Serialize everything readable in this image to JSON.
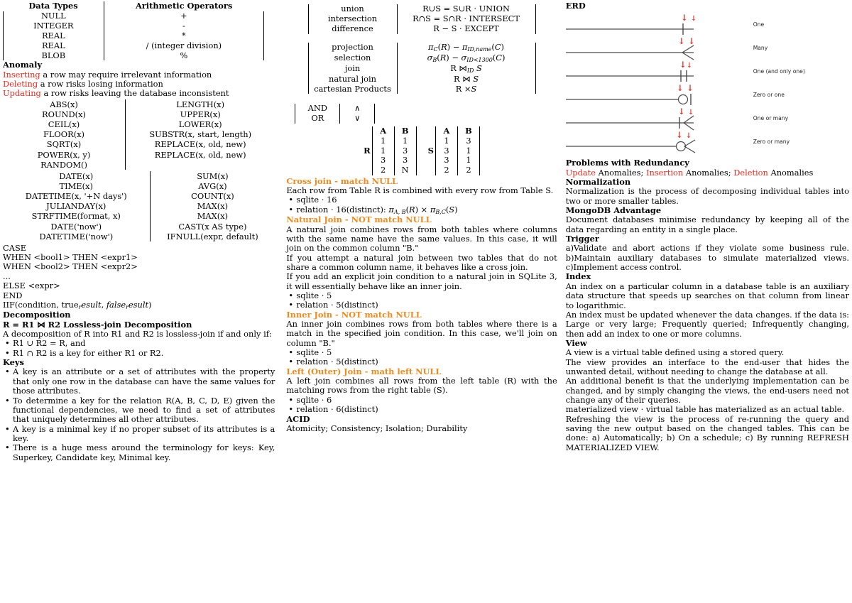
{
  "col1": {
    "datatypes_table": {
      "head_left": "Data Types",
      "head_right": "Arithmetic Operators",
      "rows": [
        {
          "type": "NULL",
          "op": "+"
        },
        {
          "type": "INTEGER",
          "op": "-"
        },
        {
          "type": "REAL",
          "op": "*"
        },
        {
          "type": "REAL",
          "op": "/ (integer division)"
        },
        {
          "type": "BLOB",
          "op": "%"
        }
      ]
    },
    "anomaly": {
      "heading": "Anomaly",
      "lines": [
        {
          "kw": "Inserting",
          "rest": " a row may require irrelevant information"
        },
        {
          "kw": "Deleting",
          "rest": " a row risks losing information"
        },
        {
          "kw": "Updating",
          "rest": " a row risks leaving the database inconsistent"
        }
      ]
    },
    "func_numeric": [
      "ABS(x)",
      "ROUND(x)",
      "CEIL(x)",
      "FLOOR(x)",
      "SQRT(x)",
      "POWER(x, y)",
      "RANDOM()"
    ],
    "func_string": [
      "LENGTH(x)",
      "UPPER(x)",
      "LOWER(x)",
      "SUBSTR(x, start, length)",
      "REPLACE(x, old, new)",
      "REPLACE(x, old, new)"
    ],
    "func_date": [
      "DATE(x)",
      "TIME(x)",
      "DATETIME(x, '+N days')",
      "JULIANDAY(x)",
      "STRFTIME(format, x)",
      "DATE('now')",
      "DATETIME('now')"
    ],
    "func_agg": [
      "SUM(x)",
      "AVG(x)",
      "COUNT(x)",
      "MAX(x)",
      "MAX(x)",
      "CAST(x AS type)",
      "IFNULL(expr, default)"
    ],
    "case_block": [
      "CASE",
      "WHEN <bool1> THEN <expr1>",
      "WHEN <bool2> THEN <expr2>",
      "...",
      "ELSE <expr>",
      "END"
    ],
    "iif": {
      "prefix": "IIF(condition, true",
      "sub1": "r",
      "mid1": "esult",
      "sep": ", ",
      "it2": "false",
      "sub2": "r",
      "mid2": "esult",
      "suffix": ")"
    },
    "decomposition": {
      "heading": "Decomposition",
      "formula": "R = R1 ⋈ R2 Lossless-join Decomposition",
      "body": "A decomposition of R into R1 and R2 is lossless-join if and only if:",
      "bullets": [
        "R1 ∪ R2 = R, and",
        "R1 ∩ R2 is a key for either R1 or R2."
      ]
    },
    "keys": {
      "heading": "Keys",
      "bullets": [
        "A key is an attribute or a set of attributes with the property that only one row in the database can have the same values for those attributes.",
        "To determine a key for the relation R(A, B, C, D, E) given the functional dependencies, we need to find a set of attributes that uniquely determines all other attributes.",
        "A key is a minimal key if no proper subset of its attributes is a key.",
        "There is a huge mess around the terminology for keys: Key, Superkey, Candidate key, Minimal key."
      ]
    }
  },
  "col2": {
    "setops": [
      {
        "name": "union",
        "expr": "R∪S = S∪R · UNION"
      },
      {
        "name": "intersection",
        "expr": "R∩S = S∩R · INTERSECT"
      },
      {
        "name": "difference",
        "expr": "R − S · EXCEPT"
      }
    ],
    "relops": [
      {
        "name": "projection",
        "expr": "πC(R) − πID,name(C)"
      },
      {
        "name": "selection",
        "expr": "σB(R) − σID<1300(C)"
      },
      {
        "name": "join",
        "expr": "R ⋈ID S"
      },
      {
        "name": "natural join",
        "expr": "R ⋈ S"
      },
      {
        "name": "cartesian Products",
        "expr": "R ×S"
      }
    ],
    "logic": [
      {
        "name": "AND",
        "sym": "∧"
      },
      {
        "name": "OR",
        "sym": "∨"
      }
    ],
    "relR": {
      "name": "R",
      "cols": [
        "A",
        "B"
      ],
      "rows": [
        [
          "1",
          "1"
        ],
        [
          "1",
          "3"
        ],
        [
          "3",
          "3"
        ],
        [
          "2",
          "N"
        ]
      ]
    },
    "relS": {
      "name": "S",
      "cols": [
        "A",
        "B"
      ],
      "rows": [
        [
          "1",
          "3"
        ],
        [
          "3",
          "1"
        ],
        [
          "3",
          "1"
        ],
        [
          "2",
          "2"
        ]
      ]
    },
    "joins": [
      {
        "title": "Cross join - match NULL",
        "body": [
          "Each row from Table R is combined with every row from Table S."
        ],
        "bullets": [
          "sqlite · 16"
        ],
        "bullet_formula": {
          "prefix": "relation · 16(distinct): ",
          "formula": "πA, B(R) × πB,C(S)"
        }
      },
      {
        "title": "Natural Join - NOT match NULL",
        "body": [
          "A natural join combines rows from both tables where columns with the same name have the same values. In this case, it will join on the common column \"B.\"",
          "If you attempt a natural join between two tables that do not share a common column name, it behaves like a cross join.",
          "If you add an explicit join condition to a natural join in SQLite 3, it will essentially behave like an inner join."
        ],
        "bullets": [
          "sqlite · 5",
          "relation · 5(distinct)"
        ]
      },
      {
        "title": "Inner Join - NOT match NULL",
        "body": [
          "An inner join combines rows from both tables where there is a match in the specified join condition. In this case, we'll join on column \"B.\""
        ],
        "bullets": [
          "sqlite · 5",
          "relation · 5(distinct)"
        ]
      },
      {
        "title": "Left (Outer) Join - math left NULL",
        "body": [
          "A left join combines all rows from the left table (R) with the matching rows from the right table (S)."
        ],
        "bullets": [
          "sqlite · 6",
          "relation · 6(distinct)"
        ]
      }
    ],
    "acid": {
      "heading": "ACID",
      "body": "Atomicity; Consistency; Isolation; Durability"
    }
  },
  "col3": {
    "erd": {
      "heading": "ERD",
      "rows": [
        {
          "label": "One",
          "symbol": "one"
        },
        {
          "label": "Many",
          "symbol": "many"
        },
        {
          "label": "One (and only one)",
          "symbol": "one-and-only-one"
        },
        {
          "label": "Zero or one",
          "symbol": "zero-or-one"
        },
        {
          "label": "One or many",
          "symbol": "one-or-many"
        },
        {
          "label": "Zero or many",
          "symbol": "zero-or-many"
        }
      ]
    },
    "redundancy": {
      "heading": "Problems with Redundancy",
      "kw1": "Update",
      "t1": " Anomalies; ",
      "kw2": "Insertion",
      "t2": " Anomalies; ",
      "kw3": "Deletion",
      "t3": " Anomalies"
    },
    "normalization": {
      "heading": "Normalization",
      "body": "Normalization is the process of decomposing individual tables into two or more smaller tables."
    },
    "mongodb": {
      "heading": "MongoDB Advantage",
      "body": "Document databases minimise redundancy by keeping all of the data regarding an entity in a single place."
    },
    "trigger": {
      "heading": "Trigger",
      "body": "a)Validate and abort actions if they violate some business rule. b)Maintain auxiliary databases to simulate materialized views. c)Implement access control."
    },
    "index": {
      "heading": "Index",
      "paras": [
        "An index on a particular column in a database table is an auxiliary data structure that speeds up searches on that column from linear to logarithmic.",
        "An index must be updated whenever the data changes. if the data is: Large or very large; Frequently queried; Infrequently changing, then add an index to one or more columns."
      ]
    },
    "view": {
      "heading": "View",
      "paras": [
        "A view is a virtual table defined using a stored query.",
        "The view provides an interface to the end-user that hides the unwanted detail, without needing to change the database at all.",
        "An additional benefit is that the underlying implementation can be changed, and by simply changing the views, the end-users need not change any of their queries.",
        "materialized view · virtual table has materialized as an actual table.",
        "Refreshing the view is the process of re-running the query and saving the new output based on the changed tables. This can be done: a) Automatically; b) On a schedule; c) By running REFRESH MATERIALIZED VIEW."
      ]
    }
  },
  "colors": {
    "accent_red": "#e8271c",
    "accent_orange": "#f08a1e",
    "text": "#000000"
  }
}
